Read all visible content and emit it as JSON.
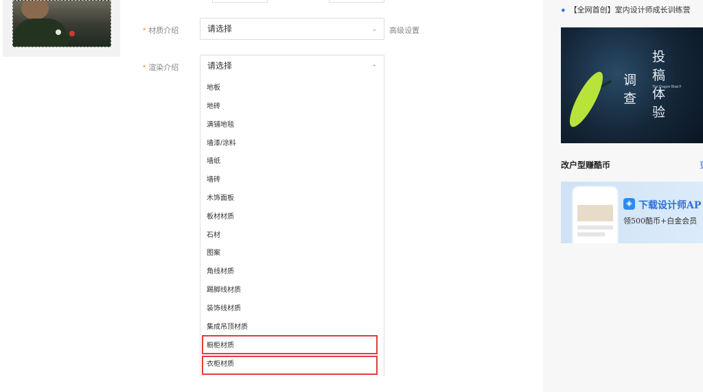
{
  "form": {
    "material_label": "材质介绍",
    "render_label": "渲染介绍",
    "material_select": "请选择",
    "render_select": "请选择",
    "advanced_settings": "高级设置",
    "chevron_down": "⌄",
    "chevron_up": "⌃"
  },
  "dropdown": {
    "options": [
      "地板",
      "地砖",
      "满铺地毯",
      "墙漆/涂料",
      "墙纸",
      "墙砖",
      "木饰面板",
      "板材材质",
      "石材",
      "图案",
      "角线材质",
      "踢脚线材质",
      "装饰线材质",
      "集成吊顶材质",
      "橱柜材质",
      "衣柜材质"
    ],
    "highlighted": [
      "橱柜材质",
      "衣柜材质"
    ]
  },
  "sidebar": {
    "news_item": "【全网首创】室内设计师成长训练营",
    "banner1": {
      "line_a": "调",
      "line_b": "查",
      "line_c": "投",
      "line_d": "稿",
      "line_e": "体",
      "line_f": "验",
      "small": "The Dragon Boat F"
    },
    "section_title": "改户型赚酷币",
    "section_more": "更",
    "banner2": {
      "title": "下载设计师AP",
      "subtitle": "领500酷币+白金会员"
    }
  },
  "icons": {
    "app": "shield-icon"
  },
  "colors": {
    "required_star": "#f08a24",
    "highlight_border": "#e03a3a",
    "accent_blue": "#3a76d9"
  }
}
